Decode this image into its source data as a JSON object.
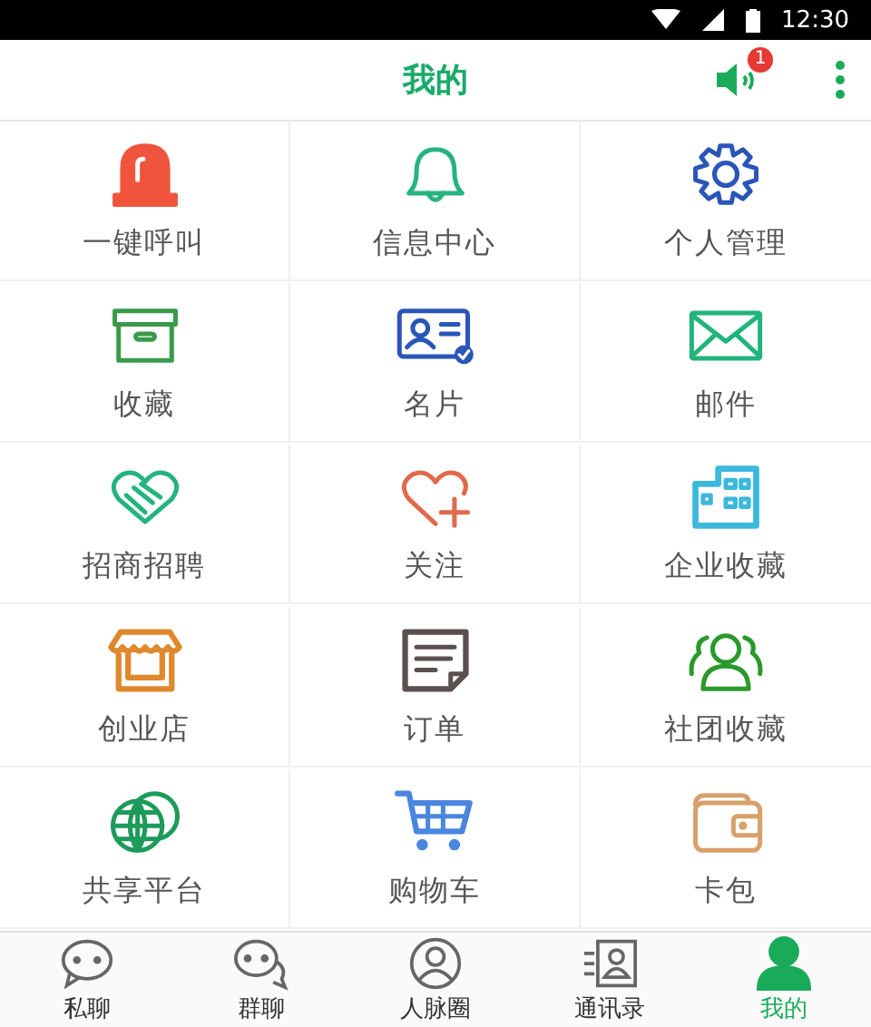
{
  "status_bar": {
    "time": "12:30"
  },
  "header": {
    "title": "我的",
    "notification_badge": "1"
  },
  "grid": [
    {
      "label": "一键呼叫",
      "kind": "alarm",
      "color": "#f0543c"
    },
    {
      "label": "信息中心",
      "kind": "bell",
      "color": "#25b47e"
    },
    {
      "label": "个人管理",
      "kind": "gear",
      "color": "#2a56b8"
    },
    {
      "label": "收藏",
      "kind": "box",
      "color": "#3a9a4a"
    },
    {
      "label": "名片",
      "kind": "card",
      "color": "#2a56b8"
    },
    {
      "label": "邮件",
      "kind": "mail",
      "color": "#22b47a"
    },
    {
      "label": "招商招聘",
      "kind": "handshake",
      "color": "#25b47e"
    },
    {
      "label": "关注",
      "kind": "heart",
      "color": "#e06a4a"
    },
    {
      "label": "企业收藏",
      "kind": "building",
      "color": "#3bb8dc"
    },
    {
      "label": "创业店",
      "kind": "shop",
      "color": "#e0882c"
    },
    {
      "label": "订单",
      "kind": "doc",
      "color": "#5a5050"
    },
    {
      "label": "社团收藏",
      "kind": "group",
      "color": "#2a9a2a"
    },
    {
      "label": "共享平台",
      "kind": "globe",
      "color": "#1e9a5a"
    },
    {
      "label": "购物车",
      "kind": "cart",
      "color": "#4a86e0"
    },
    {
      "label": "卡包",
      "kind": "wallet",
      "color": "#d8a06a"
    }
  ],
  "tabs": [
    {
      "label": "私聊",
      "kind": "chat",
      "selected": false
    },
    {
      "label": "群聊",
      "kind": "chats",
      "selected": false
    },
    {
      "label": "人脉圈",
      "kind": "person",
      "selected": false
    },
    {
      "label": "通讯录",
      "kind": "contacts",
      "selected": false
    },
    {
      "label": "我的",
      "kind": "me",
      "selected": true
    }
  ]
}
